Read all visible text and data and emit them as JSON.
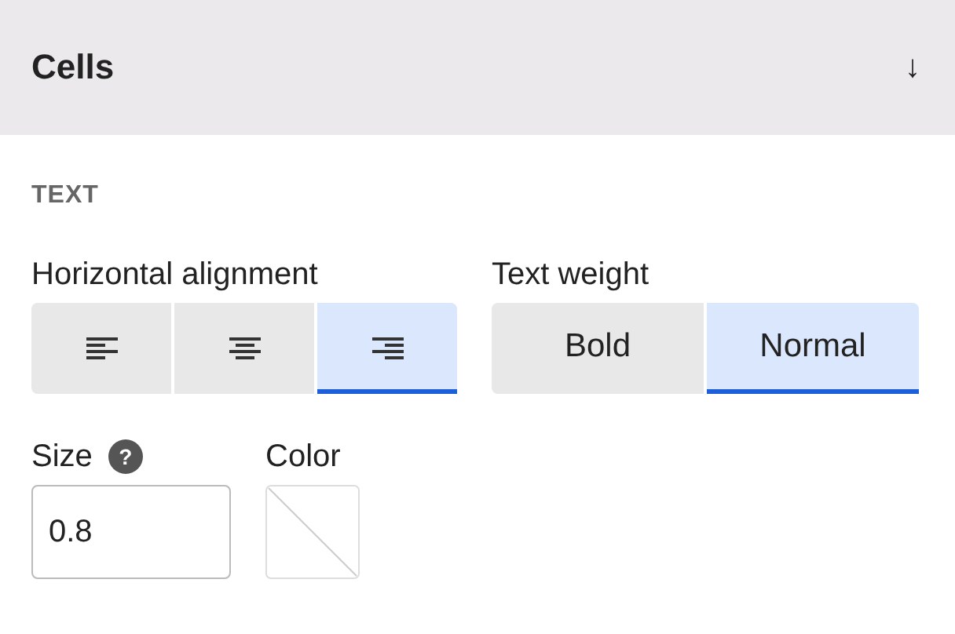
{
  "panel": {
    "title": "Cells",
    "toggle": "↓"
  },
  "section": "TEXT",
  "horizontal_alignment": {
    "label": "Horizontal alignment",
    "options": [
      {
        "kind": "left",
        "selected": false
      },
      {
        "kind": "center",
        "selected": false
      },
      {
        "kind": "right",
        "selected": true
      }
    ]
  },
  "text_weight": {
    "label": "Text weight",
    "options": [
      {
        "label": "Bold",
        "selected": false
      },
      {
        "label": "Normal",
        "selected": true
      }
    ]
  },
  "size": {
    "label": "Size",
    "help": "?",
    "value": "0.8"
  },
  "color": {
    "label": "Color"
  }
}
